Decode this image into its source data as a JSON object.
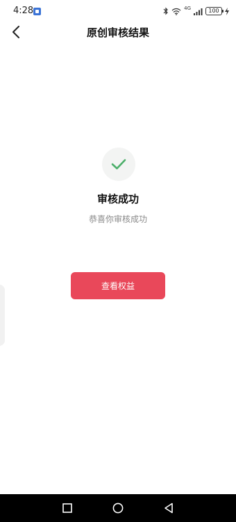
{
  "status_bar": {
    "time": "4:28",
    "network": "4G",
    "battery_level": "100"
  },
  "header": {
    "title": "原创审核结果"
  },
  "result": {
    "title": "审核成功",
    "subtitle": "恭喜你审核成功",
    "status_icon": "check-icon",
    "accent_color": "#4caf6a"
  },
  "actions": {
    "view_benefits_label": "查看权益",
    "button_color": "#e9485a"
  },
  "system_nav": {
    "recents_icon": "square-icon",
    "home_icon": "circle-icon",
    "back_icon": "triangle-back-icon"
  }
}
